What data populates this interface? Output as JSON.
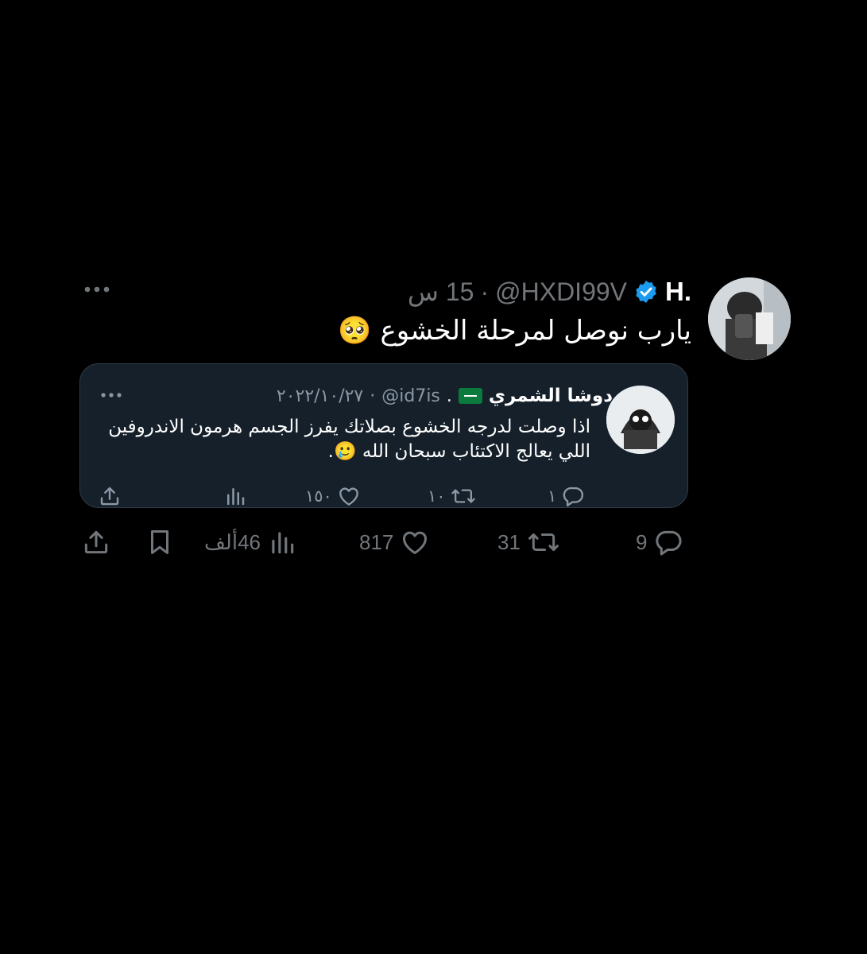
{
  "tweet": {
    "author": {
      "display_name": "H.",
      "handle": "@HXDI99V",
      "verified": true
    },
    "time": "15 س",
    "separator": "·",
    "text": "يارب نوصل لمرحلة الخشوع 🥺",
    "stats": {
      "replies": "9",
      "retweets": "31",
      "likes": "817",
      "views": "46ألف"
    }
  },
  "quoted": {
    "author": {
      "display_name": "دوشا الشمري",
      "handle": "@id7is",
      "suffix": "."
    },
    "date": "٢٠٢٢/١٠/٢٧",
    "separator": "·",
    "text": "اذا وصلت لدرجه الخشوع بصلاتك يفرز الجسم هرمون الاندروفين اللي يعالج الاكتئاب سبحان الله 🥲.",
    "stats": {
      "replies": "١",
      "retweets": "١٠",
      "likes": "١٥٠"
    }
  },
  "colors": {
    "background": "#000000",
    "card_background": "#15202b",
    "muted": "#71767b",
    "verified": "#1d9bf0"
  },
  "icons": [
    "more-icon",
    "verified-icon",
    "reply-icon",
    "retweet-icon",
    "like-icon",
    "views-icon",
    "bookmark-icon",
    "share-icon",
    "flag-icon"
  ]
}
